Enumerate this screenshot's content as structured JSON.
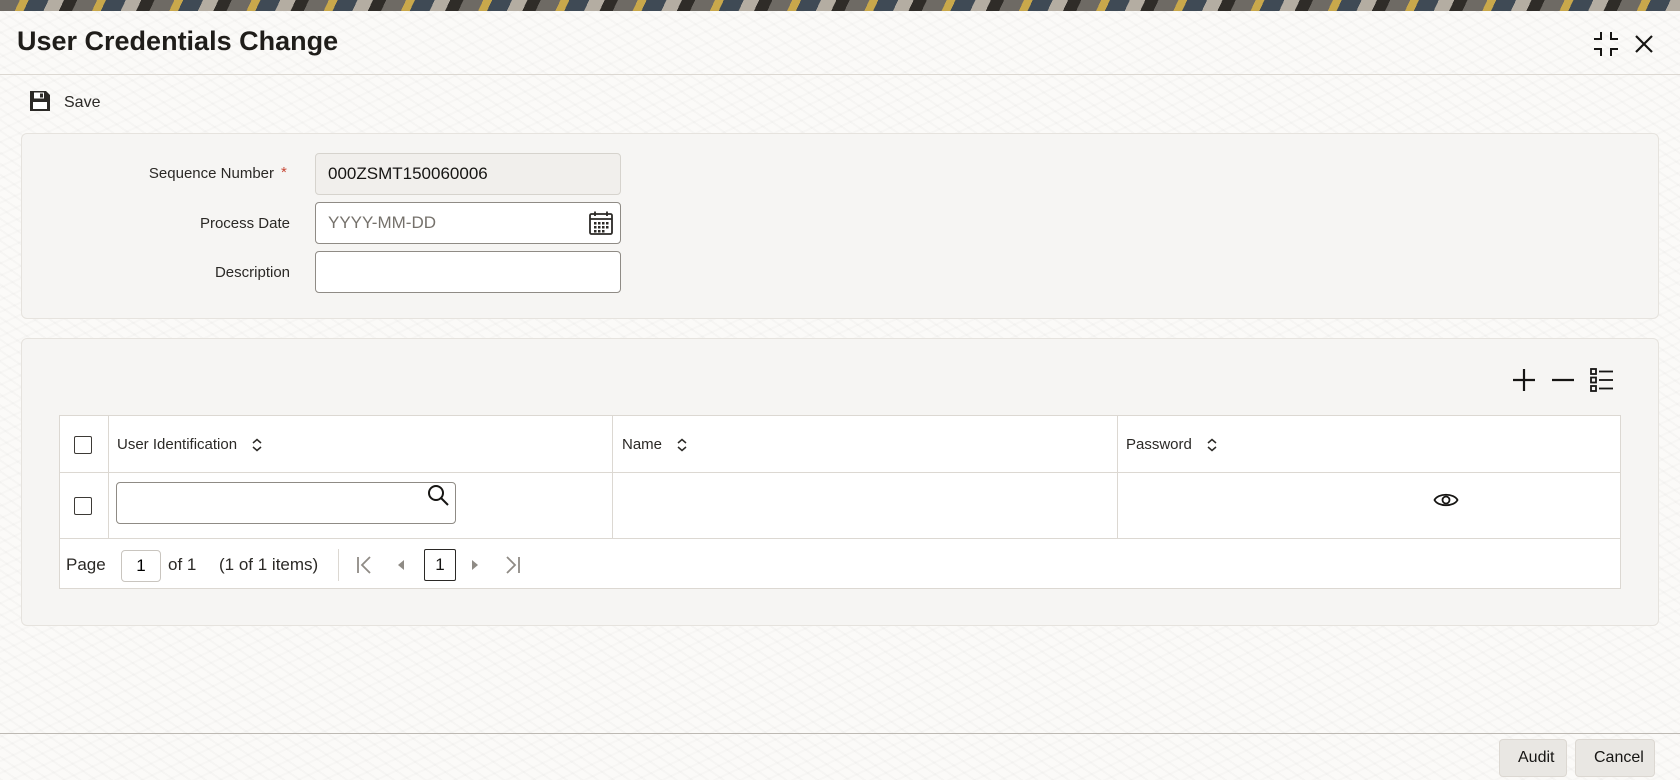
{
  "window": {
    "title": "User Credentials Change"
  },
  "toolbar": {
    "save_label": "Save"
  },
  "form": {
    "sequence_number": {
      "label": "Sequence Number",
      "required_marker": "*",
      "value": "000ZSMT150060006"
    },
    "process_date": {
      "label": "Process Date",
      "placeholder": "YYYY-MM-DD",
      "value": ""
    },
    "description": {
      "label": "Description",
      "value": ""
    }
  },
  "grid": {
    "columns": [
      "User Identification",
      "Name",
      "Password"
    ],
    "rows": [
      {
        "user_identification": "",
        "name": "",
        "password": ""
      }
    ],
    "pagination": {
      "page_label": "Page",
      "current_page": "1",
      "of_label": "of 1",
      "items_label": "(1 of 1 items)",
      "page_button": "1"
    }
  },
  "footer": {
    "audit_label": "Audit",
    "cancel_label": "Cancel"
  },
  "icons": {
    "save": "save-icon",
    "minimize": "minimize-icon",
    "close": "close-icon",
    "calendar": "calendar-icon",
    "add_row": "plus-icon",
    "delete_row": "minus-icon",
    "single_record_view": "list-view-icon",
    "sort": "sort-icon",
    "search": "search-icon",
    "show_password": "eye-icon"
  },
  "colors": {
    "required": "#c74634",
    "panel_background": "#f6f5f3"
  }
}
